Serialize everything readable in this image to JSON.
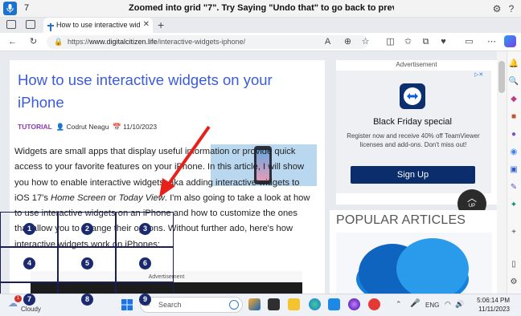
{
  "voice_bar": {
    "grid_number": "7",
    "message": "Zoomed into grid \"7\".  Try Saying \"Undo that\" to go back to previous grid..."
  },
  "browser": {
    "tab_title": "How to use interactive widgets on",
    "url_prefix": "https://",
    "url_host": "www.digitalcitizen.life",
    "url_path": "/interactive-widgets-iphone/"
  },
  "article": {
    "title": "How to use interactive widgets on your iPhone",
    "category": "TUTORIAL",
    "author": "Codrut Neagu",
    "date": "11/10/2023",
    "body_1": "Widgets are small apps that display useful information or provide quick access to your favorite features on your iPhone. In this article, I will show you how to enable interactive widgets, aka adding interactive widgets to iOS 17's ",
    "body_home": "Home Screen",
    "body_or": " or ",
    "body_today": "Today View",
    "body_2": ". I'm also going to take a look at how to use interactive widgets on an iPhone and how to customize the ones that allow you to change their options. Without further ado, here's how interactive widgets work on iPhones:",
    "ad_strip_label": "Advertisement"
  },
  "sidebar_ad": {
    "label": "Advertisement",
    "heading": "Black Friday special",
    "text": "Register now and receive 40% off TeamViewer licenses and add-ons. Don't miss out!",
    "button": "Sign Up"
  },
  "up_button": "UP",
  "popular": "POPULAR ARTICLES",
  "grid": [
    "1",
    "2",
    "3",
    "4",
    "5",
    "6",
    "7",
    "8",
    "9"
  ],
  "taskbar": {
    "weather": "Cloudy",
    "weather_badge": "1",
    "search_placeholder": "Search",
    "language": "ENG",
    "time": "5:06:14 PM",
    "date": "11/11/2023"
  },
  "colors": {
    "title_blue": "#3b5bd9",
    "category_purple": "#8d3bb3",
    "signup_navy": "#0b2d6b",
    "grid_navy": "#1b2a6f"
  }
}
